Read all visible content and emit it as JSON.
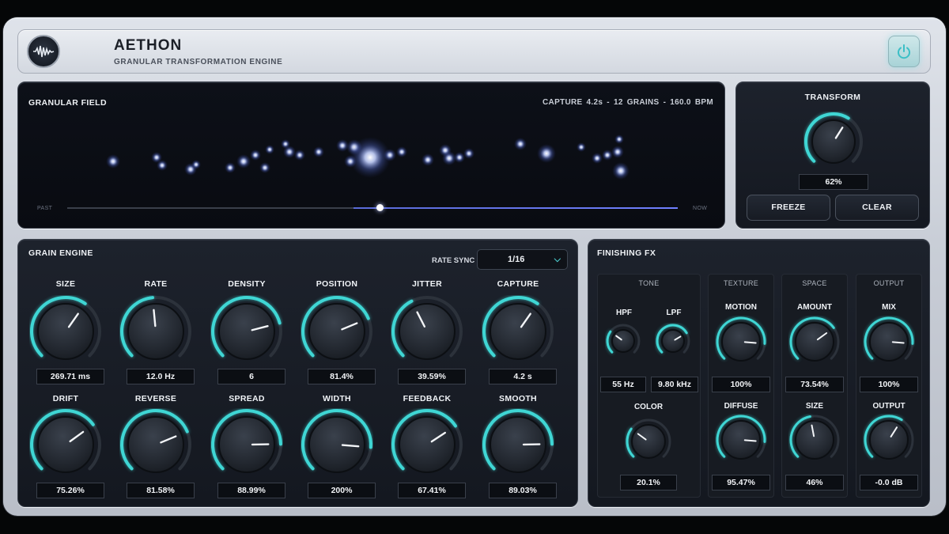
{
  "app": {
    "title": "AETHON",
    "subtitle": "GRANULAR TRANSFORMATION ENGINE",
    "logo_icon": "waveform-icon",
    "power_icon": "power-icon"
  },
  "field": {
    "title": "GRANULAR FIELD",
    "info": "CAPTURE 4.2s  -  12 GRAINS  -  160.0 BPM",
    "past_label": "PAST",
    "now_label": "NOW",
    "playhead": 0.51
  },
  "transform": {
    "title": "TRANSFORM",
    "value": "62%",
    "amount": 0.62,
    "freeze_label": "FREEZE",
    "clear_label": "CLEAR"
  },
  "engine": {
    "title": "GRAIN ENGINE",
    "rate_sync_label": "RATE SYNC",
    "rate_sync_value": "1/16",
    "knobs_row1": [
      {
        "label": "SIZE",
        "value": "269.71 ms",
        "pos": 0.63
      },
      {
        "label": "RATE",
        "value": "12.0 Hz",
        "pos": 0.48
      },
      {
        "label": "DENSITY",
        "value": "6",
        "pos": 0.78
      },
      {
        "label": "POSITION",
        "value": "81.4%",
        "pos": 0.75
      },
      {
        "label": "JITTER",
        "value": "39.59%",
        "pos": 0.4
      },
      {
        "label": "CAPTURE",
        "value": "4.2 s",
        "pos": 0.63
      }
    ],
    "knobs_row2": [
      {
        "label": "DRIFT",
        "value": "75.26%",
        "pos": 0.7
      },
      {
        "label": "REVERSE",
        "value": "81.58%",
        "pos": 0.75
      },
      {
        "label": "SPREAD",
        "value": "88.99%",
        "pos": 0.83
      },
      {
        "label": "WIDTH",
        "value": "200%",
        "pos": 0.85
      },
      {
        "label": "FEEDBACK",
        "value": "67.41%",
        "pos": 0.71
      },
      {
        "label": "SMOOTH",
        "value": "89.03%",
        "pos": 0.83
      }
    ]
  },
  "fx": {
    "title": "FINISHING FX",
    "tone": {
      "title": "TONE",
      "hpf_label": "HPF",
      "hpf_value": "55 Hz",
      "hpf_pos": 0.3,
      "lpf_label": "LPF",
      "lpf_value": "9.80 kHz",
      "lpf_pos": 0.72,
      "color_label": "COLOR",
      "color_value": "20.1%",
      "color_pos": 0.3
    },
    "texture": {
      "title": "TEXTURE",
      "motion_label": "MOTION",
      "motion_value": "100%",
      "motion_pos": 0.85,
      "diffuse_label": "DIFFUSE",
      "diffuse_value": "95.47%",
      "diffuse_pos": 0.85
    },
    "space": {
      "title": "SPACE",
      "amount_label": "AMOUNT",
      "amount_value": "73.54%",
      "amount_pos": 0.7,
      "size_label": "SIZE",
      "size_value": "46%",
      "size_pos": 0.46
    },
    "output": {
      "title": "OUTPUT",
      "mix_label": "MIX",
      "mix_value": "100%",
      "mix_pos": 0.85,
      "output_label": "OUTPUT",
      "output_value": "-0.0 dB",
      "output_pos": 0.62
    }
  },
  "colors": {
    "accent": "#3fd6d4",
    "grain": "#9fb4ff",
    "panel": "#171b23"
  }
}
